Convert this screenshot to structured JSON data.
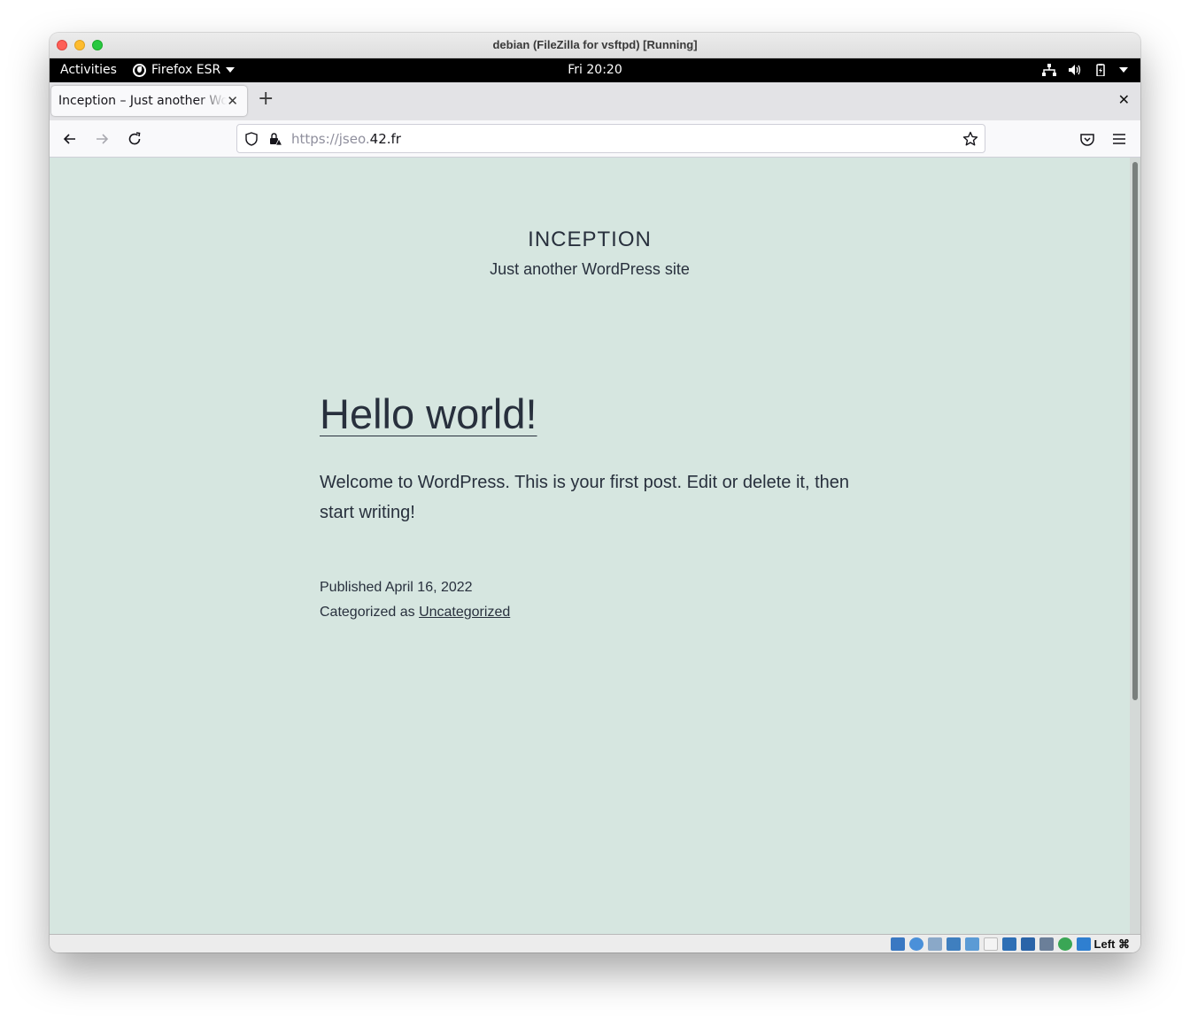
{
  "vm_window": {
    "title": "debian (FileZilla for vsftpd) [Running]"
  },
  "gnome_bar": {
    "activities": "Activities",
    "app_menu": "Firefox ESR",
    "clock": "Fri 20:20",
    "tray_icons": [
      "network-icon",
      "volume-icon",
      "battery-icon",
      "system-menu-arrow-icon"
    ]
  },
  "browser": {
    "tab": {
      "title": "Inception – Just another WordPress site"
    },
    "new_tab_label": "+",
    "url": {
      "scheme": "https://jseo.",
      "host": "42.fr"
    }
  },
  "page": {
    "site_title": "INCEPTION",
    "site_description": "Just another WordPress site",
    "post": {
      "title": "Hello world!",
      "body": "Welcome to WordPress. This is your first post. Edit or delete it, then start writing!",
      "published": "Published April 16, 2022",
      "categorized_prefix": "Categorized as ",
      "category": "Uncategorized"
    }
  },
  "vbox_status": {
    "host_key": "Left ⌘",
    "icons": [
      "hard-disk-icon",
      "optical-drive-icon",
      "audio-icon",
      "network-adapter-icon",
      "usb-icon",
      "shared-folder-icon",
      "display-icon",
      "screen-capture-icon",
      "recording-icon",
      "cpu-icon",
      "mouse-integration-icon",
      "keyboard-capture-icon"
    ]
  },
  "colors": {
    "page_background": "#d6e6e0",
    "text": "#28303d",
    "gnome_bar": "#000000"
  }
}
